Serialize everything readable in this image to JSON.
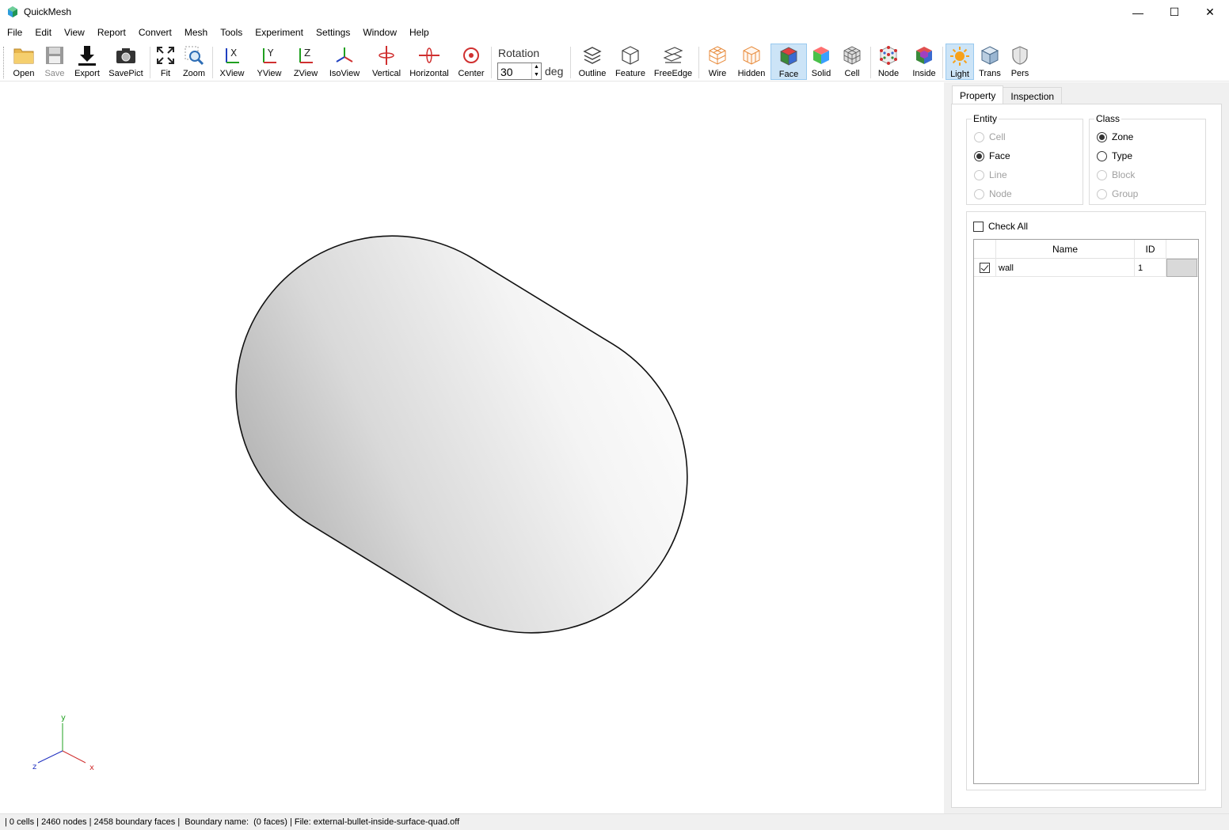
{
  "window": {
    "title": "QuickMesh",
    "controls": {
      "minimize": "—",
      "maximize": "☐",
      "close": "✕"
    }
  },
  "menu": [
    "File",
    "Edit",
    "View",
    "Report",
    "Convert",
    "Mesh",
    "Tools",
    "Experiment",
    "Settings",
    "Window",
    "Help"
  ],
  "toolbar": {
    "open": "Open",
    "save": "Save",
    "export": "Export",
    "savepict": "SavePict",
    "fit": "Fit",
    "zoom": "Zoom",
    "xview": "XView",
    "yview": "YView",
    "zview": "ZView",
    "isoview": "IsoView",
    "vertical": "Vertical",
    "horizontal": "Horizontal",
    "center": "Center",
    "rotation_label": "Rotation",
    "rotation_value": "30",
    "rotation_unit": "deg",
    "outline": "Outline",
    "feature": "Feature",
    "freeedge": "FreeEdge",
    "wire": "Wire",
    "hidden": "Hidden",
    "face": "Face",
    "solid": "Solid",
    "cell": "Cell",
    "node": "Node",
    "inside": "Inside",
    "light": "Light",
    "trans": "Trans",
    "pers": "Pers"
  },
  "axes": {
    "x": "x",
    "y": "y",
    "z": "z"
  },
  "panel": {
    "tabs": [
      "Property",
      "Inspection"
    ],
    "entity": {
      "title": "Entity",
      "options": [
        "Cell",
        "Face",
        "Line",
        "Node"
      ],
      "selected": "Face"
    },
    "class": {
      "title": "Class",
      "options": [
        "Zone",
        "Type",
        "Block",
        "Group"
      ],
      "selected": "Zone"
    },
    "check_all": "Check All",
    "table": {
      "columns": [
        "Name",
        "ID"
      ],
      "rows": [
        {
          "name": "wall",
          "id": "1",
          "checked": true
        }
      ]
    }
  },
  "status": "| 0 cells | 2460 nodes | 2458 boundary faces |  Boundary name:  (0 faces) | File: external-bullet-inside-surface-quad.off",
  "colors": {
    "active_tool": "#cce4f7",
    "panel_bg": "#f0f0f0",
    "mesh_fill": "#efefef",
    "axis_x": "#d03030",
    "axis_y": "#20a020",
    "axis_z": "#2030c0"
  }
}
